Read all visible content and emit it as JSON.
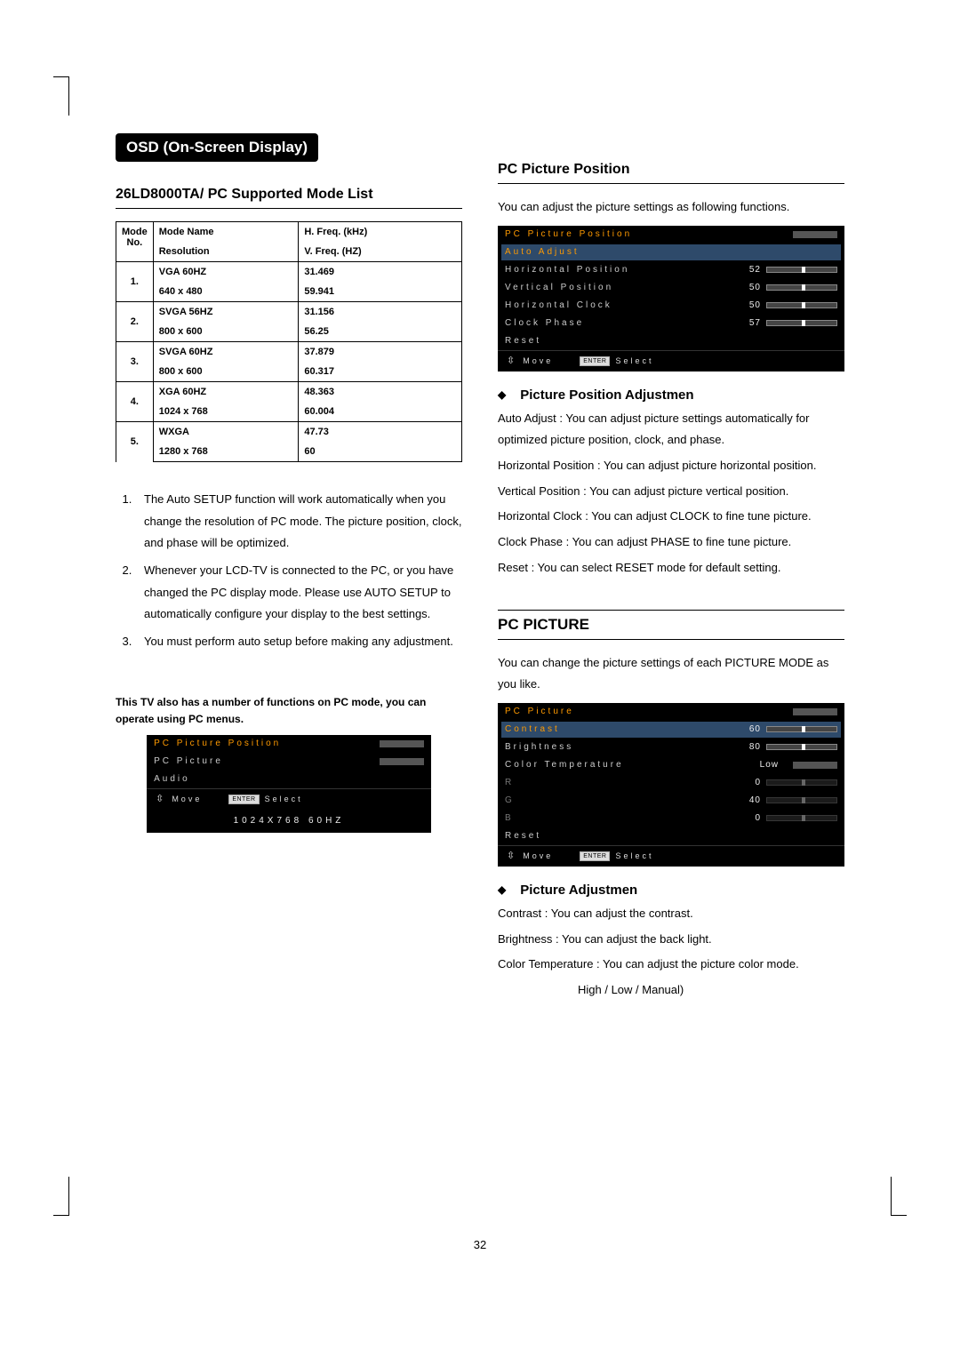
{
  "tab": "OSD (On-Screen Display)",
  "left": {
    "heading": "26LD8000TA/ PC Supported Mode List",
    "table": {
      "head": {
        "c1a": "Mode",
        "c1b": "No.",
        "c2a": "Mode Name",
        "c2b": "Resolution",
        "c3a": "H. Freq. (kHz)",
        "c3b": "V. Freq. (HZ)"
      },
      "rows": [
        {
          "no": "1.",
          "name": "VGA 60HZ",
          "res": "640 x 480",
          "h": "31.469",
          "v": "59.941"
        },
        {
          "no": "2.",
          "name": "SVGA 56HZ",
          "res": "800 x 600",
          "h": "31.156",
          "v": "56.25"
        },
        {
          "no": "3.",
          "name": "SVGA 60HZ",
          "res": "800 x 600",
          "h": "37.879",
          "v": "60.317"
        },
        {
          "no": "4.",
          "name": "XGA 60HZ",
          "res": "1024 x 768",
          "h": "48.363",
          "v": "60.004"
        },
        {
          "no": "5.",
          "name": "WXGA",
          "res": "1280 x 768",
          "h": "47.73",
          "v": "60"
        }
      ]
    },
    "notes": [
      "The Auto SETUP function will work automatically when you change the resolution of PC mode. The picture position, clock, and phase will be optimized.",
      "Whenever your LCD-TV is connected to the PC, or you have changed the PC display mode. Please use AUTO SETUP to automatically configure your display to the best settings.",
      "You must perform auto setup before making any adjustment."
    ],
    "boldnote": "This TV also has a number of functions on PC mode, you can operate using PC menus.",
    "osd1": {
      "title": "PC  Picture  Position",
      "items": [
        "PC  Picture",
        "Audio"
      ],
      "move": "Move",
      "select": "Select",
      "footer": "1024X768  60HZ"
    }
  },
  "right": {
    "h_pos": "PC Picture Position",
    "intro_pos": "You can adjust the picture settings as following functions.",
    "osd_pos": {
      "title": "PC  Picture  Position",
      "rows": [
        {
          "lbl": "Auto  Adjust",
          "val": "",
          "hl": true
        },
        {
          "lbl": "Horizontal  Position",
          "val": "52",
          "bar": true
        },
        {
          "lbl": "Vertical  Position",
          "val": "50",
          "bar": true
        },
        {
          "lbl": "Horizontal  Clock",
          "val": "50",
          "bar": true
        },
        {
          "lbl": "Clock  Phase",
          "val": "57",
          "bar": true
        },
        {
          "lbl": "Reset",
          "val": ""
        }
      ],
      "move": "Move",
      "select": "Select"
    },
    "bullet_pos": "Picture Position Adjustmen",
    "lines_pos": [
      "Auto Adjust : You can adjust picture settings automatically for optimized picture position, clock, and phase.",
      "Horizontal Position : You can adjust picture horizontal position.",
      "Vertical Position : You can adjust picture vertical position.",
      "Horizontal Clock : You can adjust CLOCK to fine tune picture.",
      "Clock Phase : You can adjust PHASE to fine tune picture.",
      "Reset : You can select RESET mode for default setting."
    ],
    "h_pic": "PC PICTURE",
    "intro_pic": "You can change the picture settings of each PICTURE MODE as you like.",
    "osd_pic": {
      "title": "PC  Picture",
      "rows": [
        {
          "lbl": "Contrast",
          "val": "60",
          "bar": true,
          "hl": true
        },
        {
          "lbl": "Brightness",
          "val": "80",
          "bar": true
        },
        {
          "lbl": "Color  Temperature",
          "val": "Low",
          "bar": false
        },
        {
          "lbl": "R",
          "val": "0",
          "bar": true,
          "dim": true
        },
        {
          "lbl": "G",
          "val": "40",
          "bar": true,
          "dim": true
        },
        {
          "lbl": "B",
          "val": "0",
          "bar": true,
          "dim": true
        },
        {
          "lbl": "Reset",
          "val": ""
        }
      ],
      "move": "Move",
      "select": "Select"
    },
    "bullet_pic": "Picture Adjustmen",
    "lines_pic": [
      "Contrast : You can adjust the contrast.",
      "Brightness : You can adjust the back light.",
      "Color Temperature : You can adjust the picture color mode."
    ],
    "sub_pic": "High / Low / Manual)"
  },
  "page": "32"
}
